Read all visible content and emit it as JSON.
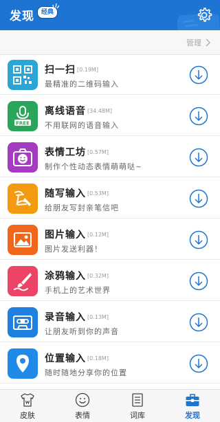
{
  "header": {
    "title": "发现",
    "badge": "经典",
    "settings_icon": "gear-icon"
  },
  "manage": {
    "label": "管理"
  },
  "plugins": [
    {
      "name": "扫一扫",
      "size": "[0.19M]",
      "desc": "最精准的二维码输入",
      "icon": "qrcode-icon",
      "color": "#2aa6d6"
    },
    {
      "name": "离线语音",
      "size": "[34.48M]",
      "desc": "不用联网的语音输入",
      "icon": "microphone-free-icon",
      "color": "#2aa65a",
      "icon_text": "FREE"
    },
    {
      "name": "表情工坊",
      "size": "[0.57M]",
      "desc": "制作个性动态表情萌萌哒~",
      "icon": "smiley-camera-icon",
      "color": "#a43bc0"
    },
    {
      "name": "随写输入",
      "size": "[0.53M]",
      "desc": "给朋友写封亲笔信吧",
      "icon": "handwriting-icon",
      "color": "#f39a12"
    },
    {
      "name": "图片输入",
      "size": "[0.12M]",
      "desc": "图片发送利器！",
      "icon": "picture-icon",
      "color": "#f0671b"
    },
    {
      "name": "涂鸦输入",
      "size": "[0.32M]",
      "desc": "手机上的艺术世界",
      "icon": "brush-icon",
      "color": "#ec4466"
    },
    {
      "name": "录音输入",
      "size": "[0.13M]",
      "desc": "让朋友听到你的声音",
      "icon": "cassette-icon",
      "color": "#1f80e0"
    },
    {
      "name": "位置输入",
      "size": "[0.18M]",
      "desc": "随时随地分享你的位置",
      "icon": "location-pin-icon",
      "color": "#1f8ae8"
    }
  ],
  "tabs": [
    {
      "label": "皮肤",
      "icon": "tshirt-icon",
      "active": false
    },
    {
      "label": "表情",
      "icon": "smiley-icon",
      "active": false
    },
    {
      "label": "词库",
      "icon": "book-icon",
      "active": false
    },
    {
      "label": "发现",
      "icon": "toolbox-icon",
      "active": true
    }
  ],
  "colors": {
    "accent": "#1e74d2"
  }
}
